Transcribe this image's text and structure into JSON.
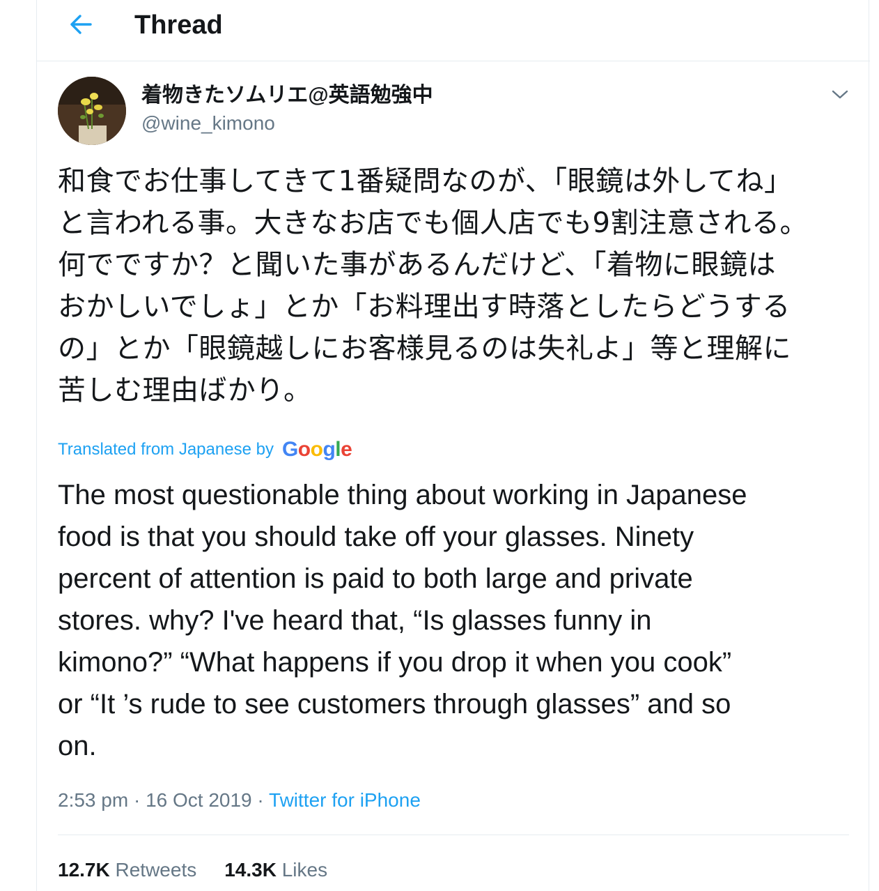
{
  "header": {
    "title": "Thread"
  },
  "tweet": {
    "author": {
      "name": "着物きたソムリエ@英語勉強中",
      "handle": "@wine_kimono"
    },
    "text_ja_lines": [
      "和食でお仕事してきて1番疑問なのが、「眼鏡は外してね」",
      "と言われる事。大きなお店でも個人店でも9割注意される。",
      "何でですか？と聞いた事があるんだけど、「着物に眼鏡は",
      "おかしいでしょ」とか「お料理出す時落としたらどうする",
      "の」とか「眼鏡越しにお客様見るのは失礼よ」等と理解に",
      "苦しむ理由ばかり。"
    ],
    "translation_label": "Translated from Japanese by",
    "translation_provider": "Google",
    "text_en_lines": [
      "The most questionable thing about working in Japanese",
      "food is that you should take off your glasses. Ninety",
      "percent of attention is paid to both large and private",
      "stores. why? I've heard that, “Is glasses funny in",
      "kimono?” “What happens if you drop it when you cook”",
      "or “It ’s rude to see customers through glasses” and so",
      "on."
    ],
    "time": "2:53 pm",
    "separator": "·",
    "date": "16 Oct 2019",
    "source": "Twitter for iPhone",
    "retweets_count": "12.7K",
    "retweets_label": "Retweets",
    "likes_count": "14.3K",
    "likes_label": "Likes"
  },
  "colors": {
    "accent": "#1da1f2",
    "text": "#14171a",
    "secondary": "#657786",
    "border": "#e6ecf0"
  },
  "icons": {
    "back": "arrow-left-icon",
    "more": "chevron-down-icon"
  }
}
